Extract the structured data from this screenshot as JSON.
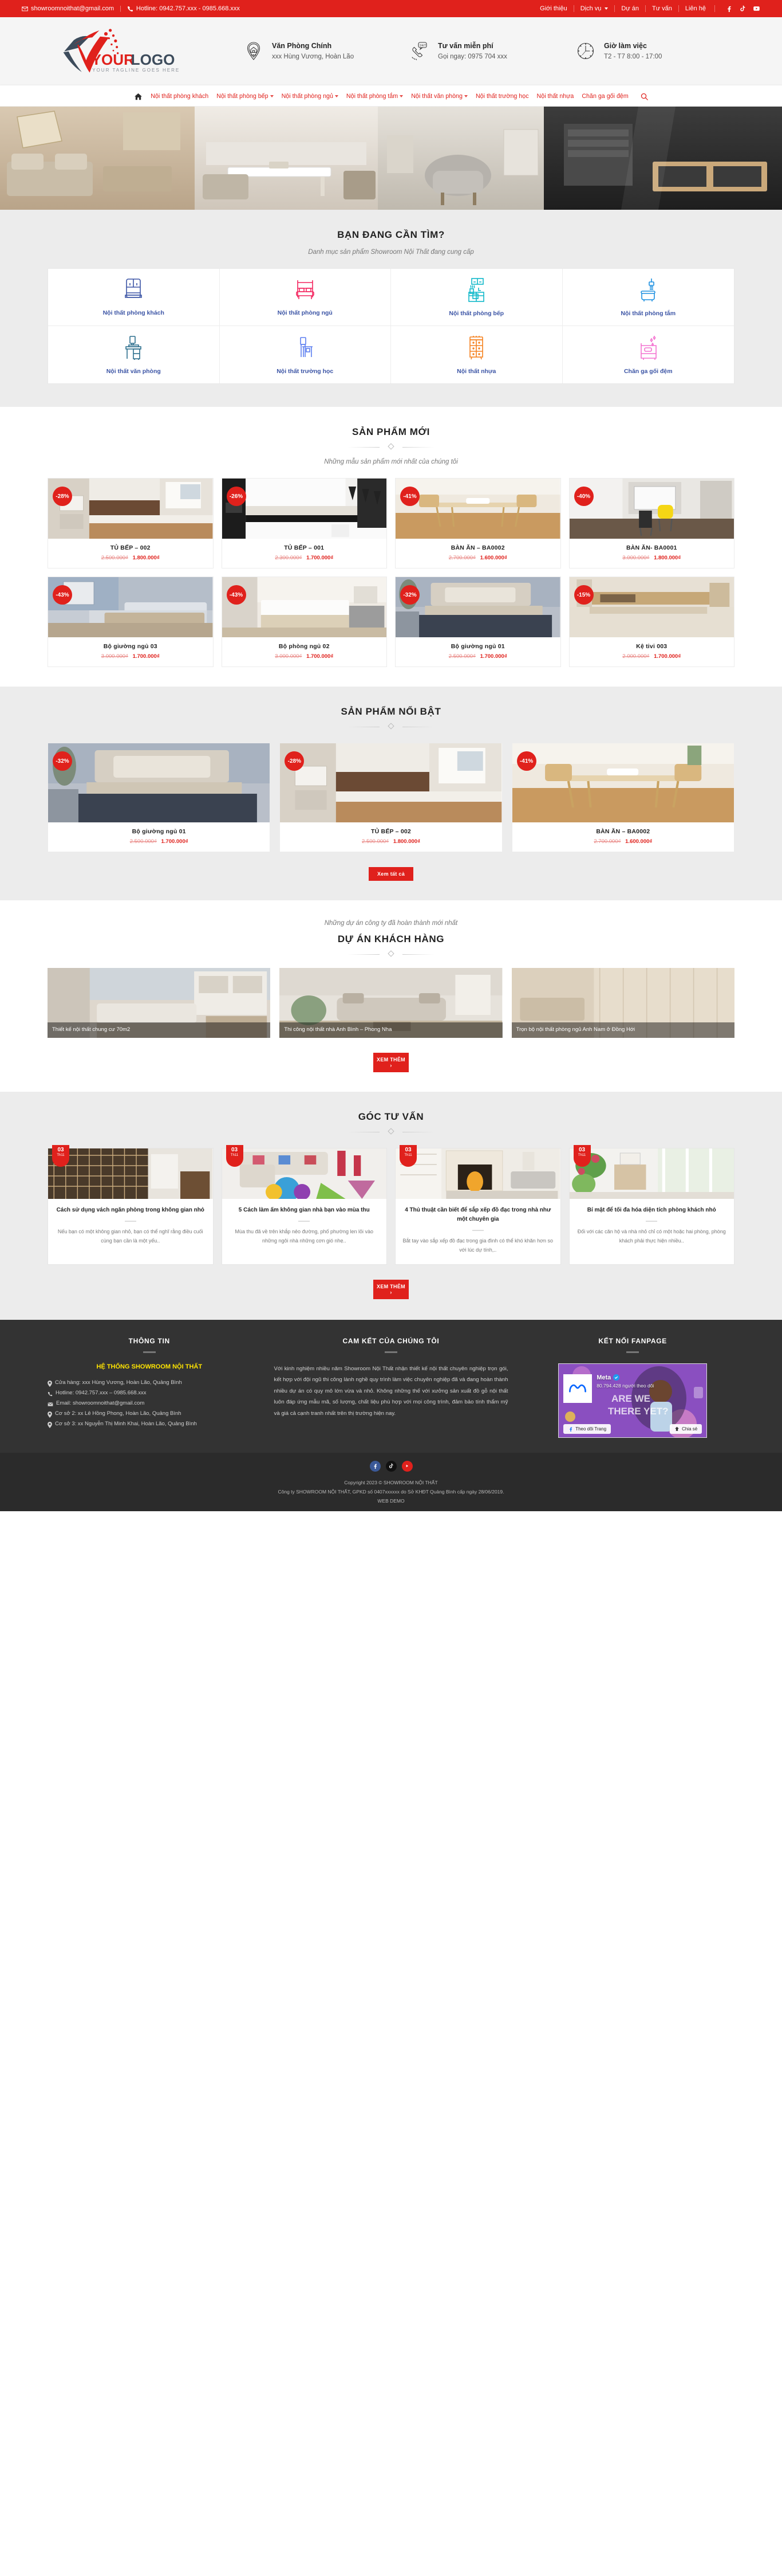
{
  "topbar": {
    "email": "showroomnoithat@gmail.com",
    "hotline": "Hotline: 0942.757.xxx - 0985.668.xxx",
    "links": [
      "Giới thiệu",
      "Dịch vụ",
      "Dự án",
      "Tư vấn",
      "Liên hệ"
    ],
    "social": [
      "facebook-icon",
      "tiktok-icon",
      "youtube-icon"
    ]
  },
  "header": {
    "logo_main": "YOUR LOGO",
    "logo_tagline": "YOUR TAGLINE GOES HERE",
    "infos": [
      {
        "icon": "location-pin-icon",
        "title": "Văn Phòng Chính",
        "value": "xxx Hùng Vương, Hoàn Lão"
      },
      {
        "icon": "phone-24-7-icon",
        "title": "Tư vấn miễn phí",
        "value": "Gọi ngay: 0975 704 xxx"
      },
      {
        "icon": "clock-icon",
        "title": "Giờ làm việc",
        "value": "T2 - T7 8:00 - 17:00"
      }
    ]
  },
  "nav": {
    "home_icon": "home-icon",
    "search_icon": "search-icon",
    "items": [
      {
        "label": "Nội thất phòng khách",
        "dropdown": false
      },
      {
        "label": "Nội thất phòng bếp",
        "dropdown": true
      },
      {
        "label": "Nội thất phòng ngủ",
        "dropdown": true
      },
      {
        "label": "Nội thất phòng tắm",
        "dropdown": true
      },
      {
        "label": "Nội thất văn phòng",
        "dropdown": true
      },
      {
        "label": "Nội thất trường học",
        "dropdown": false
      },
      {
        "label": "Nội thất nhựa",
        "dropdown": false
      },
      {
        "label": "Chăn ga gối đệm",
        "dropdown": false
      }
    ]
  },
  "categories_section": {
    "title": "BẠN ĐANG CẦN TÌM?",
    "subtitle": "Danh mục sản phẩm Showroom Nội Thất đang cung cấp",
    "items": [
      {
        "label": "Nội thất phòng khách",
        "icon": "armchair-icon",
        "color": "#3b54a5"
      },
      {
        "label": "Nội thất phòng ngủ",
        "icon": "bed-icon",
        "color": "#f4245e"
      },
      {
        "label": "Nội thất phòng bếp",
        "icon": "kitchen-icon",
        "color": "#0fb8c9"
      },
      {
        "label": "Nội thất phòng tắm",
        "icon": "bathtub-icon",
        "color": "#1c8fe0"
      },
      {
        "label": "Nội thất văn phòng",
        "icon": "office-desk-icon",
        "color": "#2d6f8e"
      },
      {
        "label": "Nội thất trường học",
        "icon": "school-desk-icon",
        "color": "#5b7ef0"
      },
      {
        "label": "Nội thất nhựa",
        "icon": "plastic-cabinet-icon",
        "color": "#f58220"
      },
      {
        "label": "Chăn ga gối đệm",
        "icon": "bedding-icon",
        "color": "#f472d0"
      }
    ]
  },
  "new_products_section": {
    "title": "SẢN PHẨM MỚI",
    "subtitle": "Những mẫu sản phẩm mới nhất của chúng tôi",
    "products": [
      {
        "name": "TỦ BẾP – 002",
        "discount": "-28%",
        "old_price": "2.500.000₫",
        "new_price": "1.800.000₫",
        "image": "kitchen-white-wood"
      },
      {
        "name": "TỦ BẾP – 001",
        "discount": "-26%",
        "old_price": "2.300.000₫",
        "new_price": "1.700.000₫",
        "image": "kitchen-glossy-white"
      },
      {
        "name": "BÀN ĂN – BA0002",
        "discount": "-41%",
        "old_price": "2.700.000₫",
        "new_price": "1.600.000₫",
        "image": "dining-table-wood"
      },
      {
        "name": "BÀN ĂN- BA0001",
        "discount": "-40%",
        "old_price": "3.000.000₫",
        "new_price": "1.800.000₫",
        "image": "dining-table-yellow-chairs"
      },
      {
        "name": "Bộ giường ngủ 03",
        "discount": "-43%",
        "old_price": "3.000.000₫",
        "new_price": "1.700.000₫",
        "image": "bedroom-blue-wall"
      },
      {
        "name": "Bộ phòng ngủ 02",
        "discount": "-43%",
        "old_price": "3.000.000₫",
        "new_price": "1.700.000₫",
        "image": "bedroom-white-bed"
      },
      {
        "name": "Bộ giường ngủ 01",
        "discount": "-32%",
        "old_price": "2.500.000₫",
        "new_price": "1.700.000₫",
        "image": "bedroom-grey-bed"
      },
      {
        "name": "Kệ tivi 003",
        "discount": "-15%",
        "old_price": "2.000.000₫",
        "new_price": "1.700.000₫",
        "image": "tv-shelf-wood"
      }
    ]
  },
  "featured_section": {
    "title": "SẢN PHẨM NỔI BẬT",
    "button": "Xem tất cả",
    "products": [
      {
        "name": "Bộ giường ngủ 01",
        "discount": "-32%",
        "old_price": "2.500.000₫",
        "new_price": "1.700.000₫",
        "image": "bedroom-grey-bed"
      },
      {
        "name": "TỦ BẾP – 002",
        "discount": "-28%",
        "old_price": "2.500.000₫",
        "new_price": "1.800.000₫",
        "image": "kitchen-white-wood"
      },
      {
        "name": "BÀN ĂN – BA0002",
        "discount": "-41%",
        "old_price": "2.700.000₫",
        "new_price": "1.600.000₫",
        "image": "dining-table-wood"
      }
    ]
  },
  "projects_section": {
    "subtitle": "Những dự án công ty đã hoàn thành mới nhất",
    "title": "DỰ ÁN KHÁCH HÀNG",
    "button": "XEM THÊM ›",
    "items": [
      {
        "caption": "Thiết kế nội thất chung cư 70m2",
        "image": "apartment-living-room"
      },
      {
        "caption": "Thi công nội thất nhà Anh Bình – Phong Nha",
        "image": "living-room-sofa"
      },
      {
        "caption": "Trọn bộ nội thất phòng ngủ Anh Nam ở Đồng Hới",
        "image": "bedroom-wood-panel"
      }
    ]
  },
  "blog_section": {
    "title": "GÓC TƯ VẤN",
    "button": "XEM THÊM ›",
    "posts": [
      {
        "day": "03",
        "month": "Th11",
        "title": "Cách sử dụng vách ngăn phòng trong không gian nhỏ",
        "excerpt": "Nếu bạn có một không gian nhỏ, bạn có thể nghĩ rằng điều cuối cùng bạn cần là một yếu..",
        "image": "room-divider"
      },
      {
        "day": "03",
        "month": "Th11",
        "title": "5 Cách làm ấm không gian nhà bạn vào mùa thu",
        "excerpt": "Mùa thu đã về trên khắp nẻo đường, phố phường len lỏi vào những ngôi nhà những cơn gió nhẹ..",
        "image": "colorful-living-room"
      },
      {
        "day": "03",
        "month": "Th11",
        "title": "4 Thủ thuật cần biết để sắp xếp đồ đạc trong nhà như một chuyên gia",
        "excerpt": "Bắt tay vào sắp xếp đồ đạc trong gia đình có thể khó khăn hơn so với lúc dự tính,..",
        "image": "fireplace-room"
      },
      {
        "day": "03",
        "month": "Th11",
        "title": "Bí mật để tối đa hóa diện tích phòng khách nhỏ",
        "excerpt": "Đối với các căn hộ và nhà nhỏ chỉ có một hoặc hai phòng, phòng khách phải thực hiện nhiều..",
        "image": "bright-plants-room"
      }
    ]
  },
  "footer": {
    "info": {
      "heading": "THÔNG TIN",
      "brand": "HỆ THỐNG SHOWROOM NỘI THẤT",
      "rows": [
        {
          "icon": "location-pin-icon",
          "text": "Cửa hàng: xxx Hùng Vương, Hoàn Lão, Quảng Bình"
        },
        {
          "icon": "phone-icon",
          "text": "Hotline: 0942.757.xxx – 0985.668.xxx"
        },
        {
          "icon": "mail-icon",
          "text": "Email: showroomnoithat@gmail.com"
        },
        {
          "icon": "location-pin-icon",
          "text": "Cơ sở 2: xx Lê Hồng Phong, Hoàn Lão, Quảng Bình"
        },
        {
          "icon": "location-pin-icon",
          "text": "Cơ sở 3: xx Nguyễn Thị Minh Khai, Hoàn Lão, Quảng Bình"
        }
      ]
    },
    "commit": {
      "heading": "CAM KẾT CỦA CHÚNG TÔI",
      "text": "Với kinh nghiệm nhiều năm Showroom Nội Thất nhận thiết kế nội thất chuyên nghiệp trọn gói, kết hợp với đội ngũ thi công lành nghề quy trình làm việc chuyên nghiệp đã và đang hoàn thành nhiều dự án có quy mô lớn vừa và nhỏ. Không những thế với xưởng sản xuất đồ gỗ nội thất luôn đáp ứng mẫu mã, số lượng, chất liệu phù hợp với mọi công trình, đảm bảo tính thẩm mỹ và giá cả cạnh tranh nhất trên thị trường hiện nay."
    },
    "fanpage": {
      "heading": "KẾT NỐI FANPAGE",
      "page_name": "Meta",
      "followers": "80.794.428 người theo dõi",
      "follow_button": "Theo dõi Trang",
      "share_button": "Chia sẻ"
    },
    "bottom": {
      "social": [
        "facebook-icon",
        "tiktok-icon",
        "youtube-icon"
      ],
      "copyright": "Copyright 2023 © SHOWROOM NỘI THẤT",
      "company": "Công ty SHOWROOM NỘI THẤT, GPKD số 0407xxxxxx do Sở KHĐT Quảng Bình cấp ngày 28/06/2019.",
      "demo": "WEB DEMO"
    }
  },
  "colors": {
    "brand_red": "#e0211c",
    "footer_bg": "#333333",
    "highlight_yellow": "#ffe400"
  }
}
